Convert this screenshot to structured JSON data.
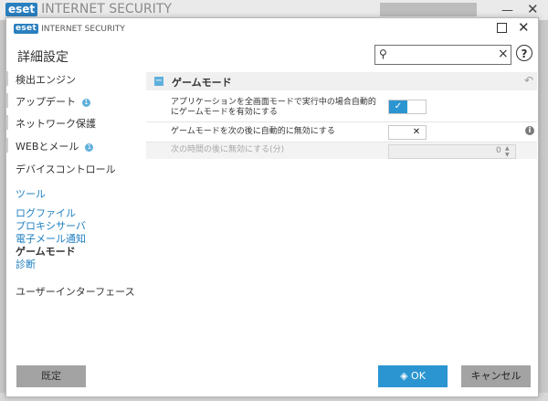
{
  "background": {
    "logo_box": "eset",
    "product_title": "INTERNET SECURITY"
  },
  "dialog": {
    "logo_box": "eset",
    "product_title": "INTERNET SECURITY",
    "heading": "詳細設定",
    "search": {
      "placeholder": "",
      "value": ""
    }
  },
  "sidebar": {
    "items": [
      {
        "label": "検出エンジン",
        "badge": ""
      },
      {
        "label": "アップデート",
        "badge": "1"
      },
      {
        "label": "ネットワーク保護",
        "badge": ""
      },
      {
        "label": "WEBとメール",
        "badge": "1"
      },
      {
        "label": "デバイスコントロール",
        "badge": ""
      }
    ],
    "tools_label": "ツール",
    "tools_items": [
      {
        "label": "ログファイル",
        "active": false
      },
      {
        "label": "プロキシサーバ",
        "active": false
      },
      {
        "label": "電子メール通知",
        "active": false
      },
      {
        "label": "ゲームモード",
        "active": true
      },
      {
        "label": "診断",
        "active": false
      }
    ],
    "ui_label": "ユーザーインターフェース"
  },
  "section": {
    "collapse_glyph": "−",
    "title": "ゲームモード",
    "undo_glyph": "↶"
  },
  "settings": [
    {
      "label": "アプリケーションを全画面モードで実行中の場合自動的にゲームモードを有効にする",
      "enabled": true
    },
    {
      "label": "ゲームモードを次の後に自動的に無効にする",
      "enabled": false
    },
    {
      "label": "次の時間の後に無効にする(分)",
      "value": "0",
      "disabled": true
    }
  ],
  "footer": {
    "default_label": "既定",
    "ok_label": "OK",
    "cancel_label": "キャンセル"
  },
  "colors": {
    "accent": "#2b95d1",
    "link": "#1e7fc0",
    "badge": "#5fb0db"
  }
}
